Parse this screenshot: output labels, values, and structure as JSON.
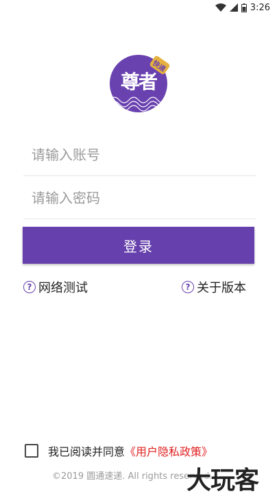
{
  "status": {
    "time": "3:26"
  },
  "logo": {
    "text": "尊者",
    "badge": "快递"
  },
  "form": {
    "account_placeholder": "请输入账号",
    "password_placeholder": "请输入密码",
    "login_label": "登录"
  },
  "links": {
    "network_test": "网络测试",
    "about_version": "关于版本"
  },
  "agreement": {
    "prefix": "我已阅读并同意",
    "policy": "《用户隐私政策》"
  },
  "footer": {
    "copyright": "©2019 圆通速递. All rights reserved."
  },
  "watermark": "大玩客",
  "colors": {
    "accent": "#6640ac",
    "policy": "#e02020",
    "badge": "#e6b13e"
  }
}
